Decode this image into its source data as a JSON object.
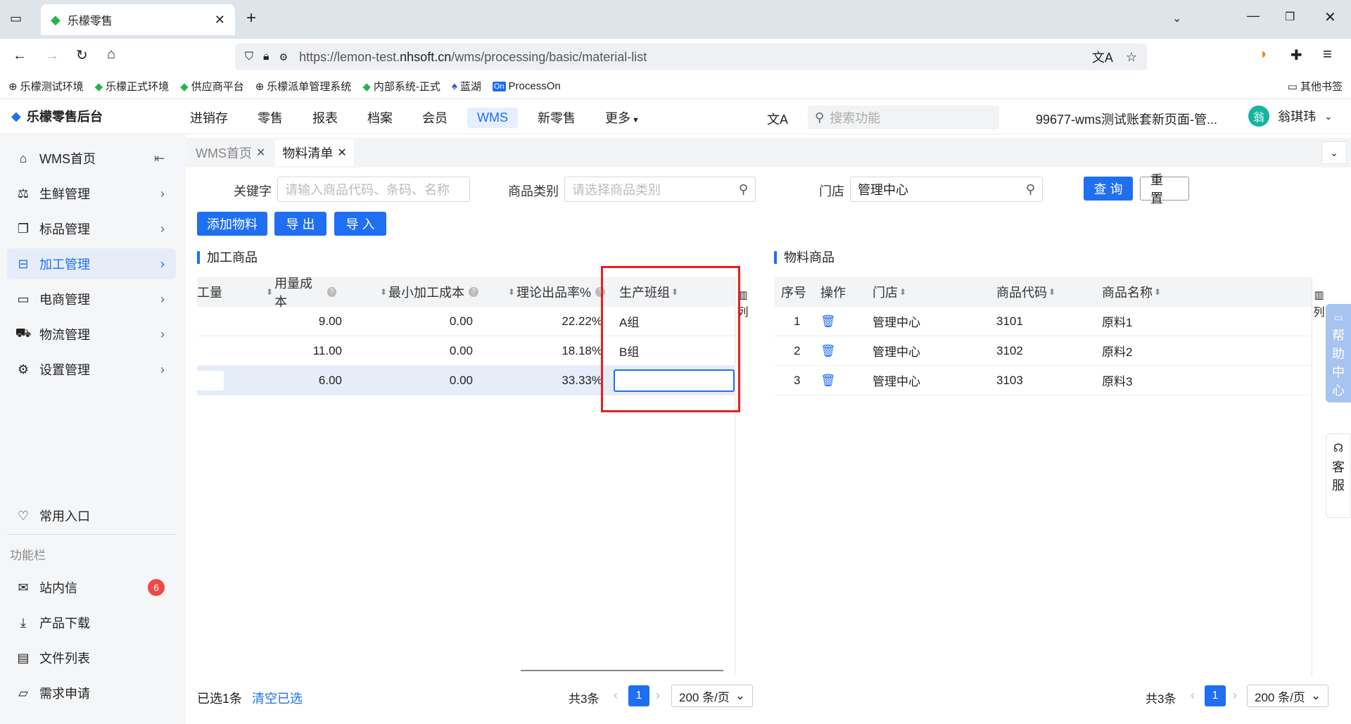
{
  "browser": {
    "tab_title": "乐檬零售",
    "url_prefix": "https://lemon-test.",
    "url_domain": "nhsoft.cn",
    "url_path": "/wms/processing/basic/material-list",
    "bookmarks": [
      "乐檬测试环境",
      "乐檬正式环境",
      "供应商平台",
      "乐檬派单管理系统",
      "内部系统-正式",
      "蓝湖",
      "ProcessOn"
    ],
    "other_bookmarks": "其他书签"
  },
  "header": {
    "logo": "乐檬零售后台",
    "nav": [
      "进销存",
      "零售",
      "报表",
      "档案",
      "会员",
      "WMS",
      "新零售",
      "更多"
    ],
    "active_nav": "WMS",
    "search_placeholder": "搜索功能",
    "account": "99677-wms测试账套新页面-管...",
    "avatar_char": "翁",
    "user_name": "翁琪玮"
  },
  "sidebar": {
    "items": [
      "WMS首页",
      "生鲜管理",
      "标品管理",
      "加工管理",
      "电商管理",
      "物流管理",
      "设置管理"
    ],
    "favorites": "常用入口",
    "section_label": "功能栏",
    "func_items": [
      "站内信",
      "产品下载",
      "文件列表",
      "需求申请"
    ],
    "inbox_badge": "6"
  },
  "page_tabs": [
    "WMS首页",
    "物料清单"
  ],
  "filters": {
    "keyword_label": "关键字",
    "keyword_placeholder": "请输入商品代码、条码、名称",
    "category_label": "商品类别",
    "category_placeholder": "请选择商品类别",
    "store_label": "门店",
    "store_value": "管理中心",
    "query": "查 询",
    "reset": "重 置"
  },
  "actions": [
    "添加物料",
    "导 出",
    "导 入"
  ],
  "left_table": {
    "title": "加工商品",
    "col_partial": "工量",
    "columns": [
      "用量成本",
      "最小加工成本",
      "理论出品率%",
      "生产班组"
    ],
    "col_icon_label": "列",
    "rows": [
      {
        "cost": "9.00",
        "min_cost": "0.00",
        "rate": "22.22%",
        "team": "A组"
      },
      {
        "cost": "11.00",
        "min_cost": "0.00",
        "rate": "18.18%",
        "team": "B组"
      },
      {
        "cost": "6.00",
        "min_cost": "0.00",
        "rate": "33.33%",
        "team": ""
      }
    ],
    "selected_text": "已选1条",
    "clear_text": "清空已选",
    "total": "共3条",
    "page": "1",
    "page_size": "200 条/页"
  },
  "right_table": {
    "title": "物料商品",
    "columns": [
      "序号",
      "操作",
      "门店",
      "商品代码",
      "商品名称"
    ],
    "col_icon_label": "列",
    "rows": [
      {
        "no": "1",
        "store": "管理中心",
        "code": "3101",
        "name": "原料1"
      },
      {
        "no": "2",
        "store": "管理中心",
        "code": "3102",
        "name": "原料2"
      },
      {
        "no": "3",
        "store": "管理中心",
        "code": "3103",
        "name": "原料3"
      }
    ],
    "total": "共3条",
    "page": "1",
    "page_size": "200 条/页"
  },
  "float": {
    "help": [
      "帮",
      "助",
      "中",
      "心"
    ],
    "service": [
      "客",
      "服"
    ]
  }
}
